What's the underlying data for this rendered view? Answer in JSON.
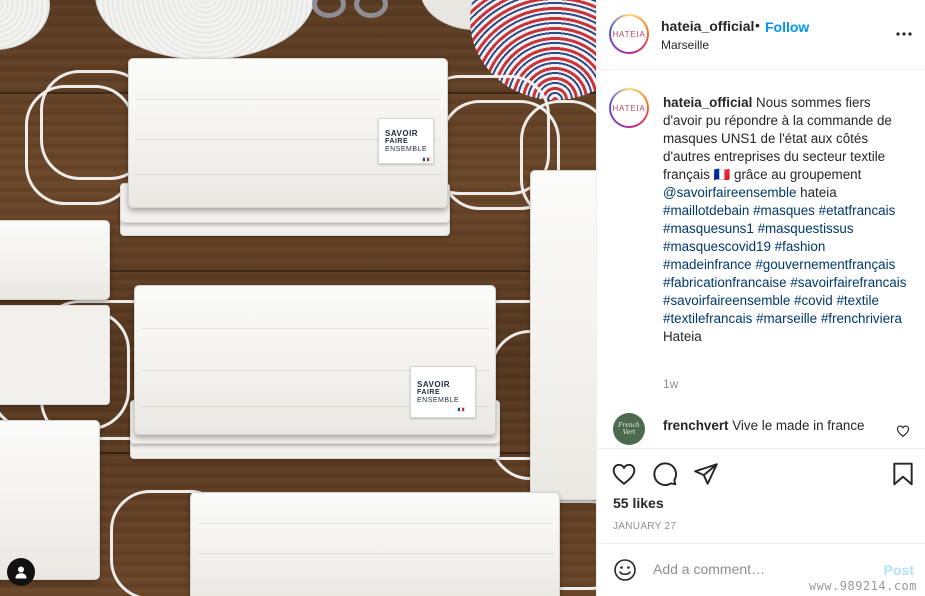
{
  "post": {
    "username": "hateia_official",
    "follow_label": "Follow",
    "separator": "•",
    "location": "Marseille",
    "avatar_text": "HATEIA"
  },
  "caption": {
    "username": "hateia_official",
    "text_parts": [
      {
        "text": " Nous sommes fiers d'avoir pu répondre à la commande de masques UNS1 de l'état aux côtés d'autres entreprises du secteur textile français ",
        "type": "plain"
      },
      {
        "text": "🇫🇷",
        "type": "plain"
      },
      {
        "text": " grâce au groupement ",
        "type": "plain"
      },
      {
        "text": "@savoirfaireensemble",
        "type": "link"
      },
      {
        "text": " hateia ",
        "type": "plain"
      },
      {
        "text": "#maillotdebain",
        "type": "link"
      },
      {
        "text": " ",
        "type": "plain"
      },
      {
        "text": "#masques",
        "type": "link"
      },
      {
        "text": " ",
        "type": "plain"
      },
      {
        "text": "#etatfrancais",
        "type": "link"
      },
      {
        "text": " ",
        "type": "plain"
      },
      {
        "text": "#masquesuns1",
        "type": "link"
      },
      {
        "text": " ",
        "type": "plain"
      },
      {
        "text": "#masquestissus",
        "type": "link"
      },
      {
        "text": " ",
        "type": "plain"
      },
      {
        "text": "#masquescovid19",
        "type": "link"
      },
      {
        "text": " ",
        "type": "plain"
      },
      {
        "text": "#fashion",
        "type": "link"
      },
      {
        "text": " ",
        "type": "plain"
      },
      {
        "text": "#madeinfrance",
        "type": "link"
      },
      {
        "text": " ",
        "type": "plain"
      },
      {
        "text": "#gouvernementfrançais",
        "type": "link"
      },
      {
        "text": " ",
        "type": "plain"
      },
      {
        "text": "#fabricationfrancaise",
        "type": "link"
      },
      {
        "text": " ",
        "type": "plain"
      },
      {
        "text": "#savoirfairefrancais",
        "type": "link"
      },
      {
        "text": " ",
        "type": "plain"
      },
      {
        "text": "#savoirfaireensemble",
        "type": "link"
      },
      {
        "text": " ",
        "type": "plain"
      },
      {
        "text": "#covid",
        "type": "link"
      },
      {
        "text": " ",
        "type": "plain"
      },
      {
        "text": "#textile",
        "type": "link"
      },
      {
        "text": " ",
        "type": "plain"
      },
      {
        "text": "#textilefrancais",
        "type": "link"
      },
      {
        "text": " ",
        "type": "plain"
      },
      {
        "text": "#marseille",
        "type": "link"
      },
      {
        "text": " ",
        "type": "plain"
      },
      {
        "text": "#frenchriviera",
        "type": "link"
      },
      {
        "text": " Hateia",
        "type": "plain"
      }
    ],
    "time_ago": "1w"
  },
  "comment": {
    "username": "frenchvert",
    "text": "Vive le made in france",
    "avatar_text": "French Vert"
  },
  "stats": {
    "likes": "55 likes",
    "date": "JANUARY 27"
  },
  "add_comment": {
    "placeholder": "Add a comment…",
    "post_label": "Post"
  },
  "photo": {
    "tag_line1": "SAVOIR",
    "tag_line2": "FAIRE",
    "tag_line3": "ENSEMBLE"
  },
  "icons": {
    "more": "more-options-icon",
    "like": "heart-icon",
    "comment": "comment-icon",
    "share": "share-icon",
    "save": "bookmark-icon",
    "emoji": "emoji-icon",
    "user_tag": "user-tag-icon"
  },
  "colors": {
    "link": "#00376b",
    "follow": "#0095f6",
    "post_disabled": "#b2dffc"
  },
  "watermark": "www.989214.com"
}
